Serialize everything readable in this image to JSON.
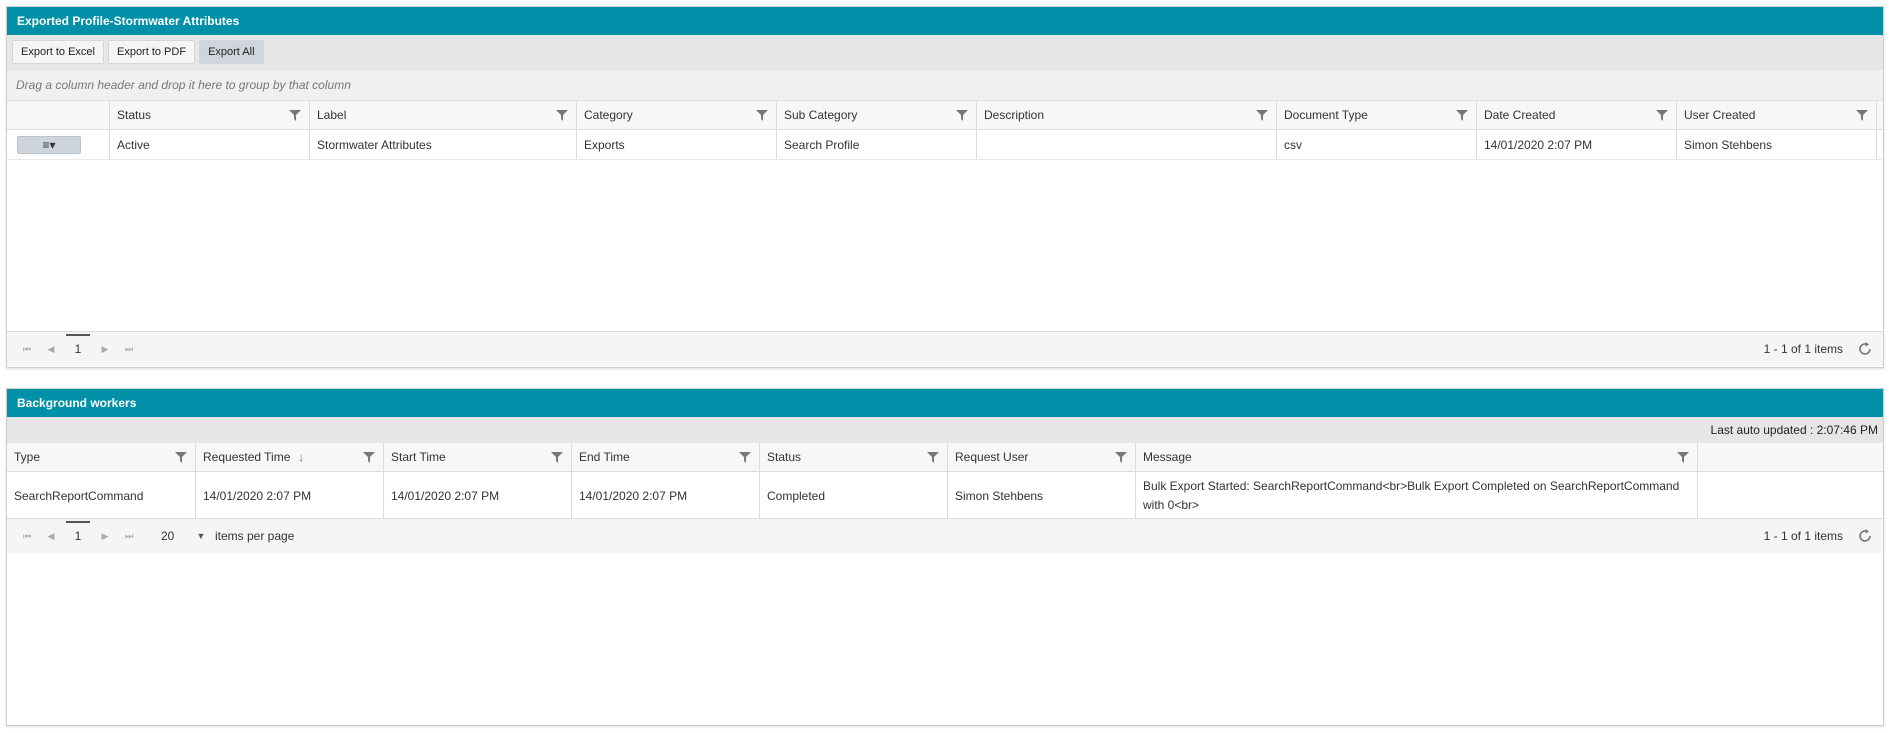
{
  "exports_panel": {
    "title": "Exported Profile-Stormwater Attributes",
    "toolbar": {
      "export_excel": "Export to Excel",
      "export_pdf": "Export to PDF",
      "export_all": "Export All"
    },
    "group_hint": "Drag a column header and drop it here to group by that column",
    "columns": [
      "Status",
      "Label",
      "Category",
      "Sub Category",
      "Description",
      "Document Type",
      "Date Created",
      "User Created"
    ],
    "rows": [
      {
        "status": "Active",
        "label": "Stormwater Attributes",
        "category": "Exports",
        "sub_category": "Search Profile",
        "description": "",
        "document_type": "csv",
        "date_created": "14/01/2020 2:07 PM",
        "user_created": "Simon Stehbens"
      }
    ],
    "row_menu_glyph": "≡▾",
    "pager": {
      "page": "1",
      "info": "1 - 1 of 1 items"
    }
  },
  "workers_panel": {
    "title": "Background workers",
    "last_updated": "Last auto updated : 2:07:46 PM",
    "columns": [
      "Type",
      "Requested Time",
      "Start Time",
      "End Time",
      "Status",
      "Request User",
      "Message"
    ],
    "sort_glyph": "↓",
    "rows": [
      {
        "type": "SearchReportCommand",
        "requested_time": "14/01/2020 2:07 PM",
        "start_time": "14/01/2020 2:07 PM",
        "end_time": "14/01/2020 2:07 PM",
        "status": "Completed",
        "request_user": "Simon Stehbens",
        "message": "Bulk Export Started: SearchReportCommand<br>Bulk Export Completed on SearchReportCommand with 0<br>"
      }
    ],
    "pager": {
      "page": "1",
      "per_page_value": "20",
      "per_page_label": "items per page",
      "info": "1 - 1 of 1 items"
    }
  },
  "colors": {
    "header_teal": "#0090a8",
    "toolbar_gray": "#e6e6e6"
  }
}
